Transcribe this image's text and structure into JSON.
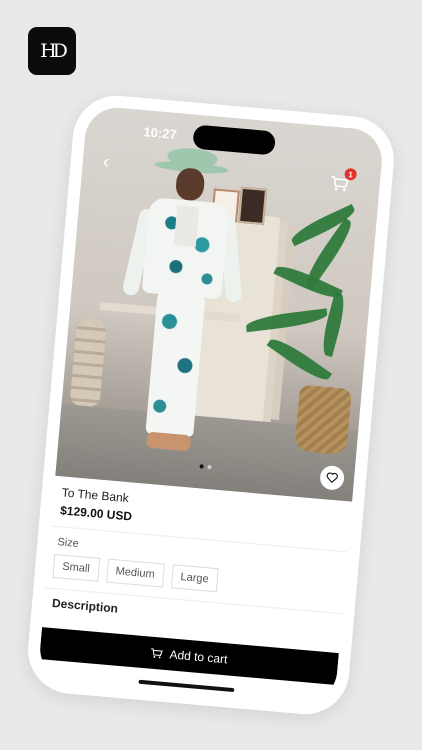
{
  "brand": {
    "logo_text": "HD"
  },
  "status": {
    "time": "10:27"
  },
  "nav": {
    "back_icon": "chevron-left-icon",
    "cart_icon": "cart-icon",
    "cart_badge": "1"
  },
  "product": {
    "name": "To The Bank",
    "price": "$129.00 USD",
    "image_dots": 2,
    "active_dot": 0
  },
  "size": {
    "label": "Size",
    "options": [
      "Small",
      "Medium",
      "Large"
    ]
  },
  "description": {
    "title": "Description"
  },
  "cta": {
    "label": "Add to cart"
  },
  "colors": {
    "accent": "#000000",
    "badge": "#e0312b",
    "background": "#e9e9e9"
  }
}
